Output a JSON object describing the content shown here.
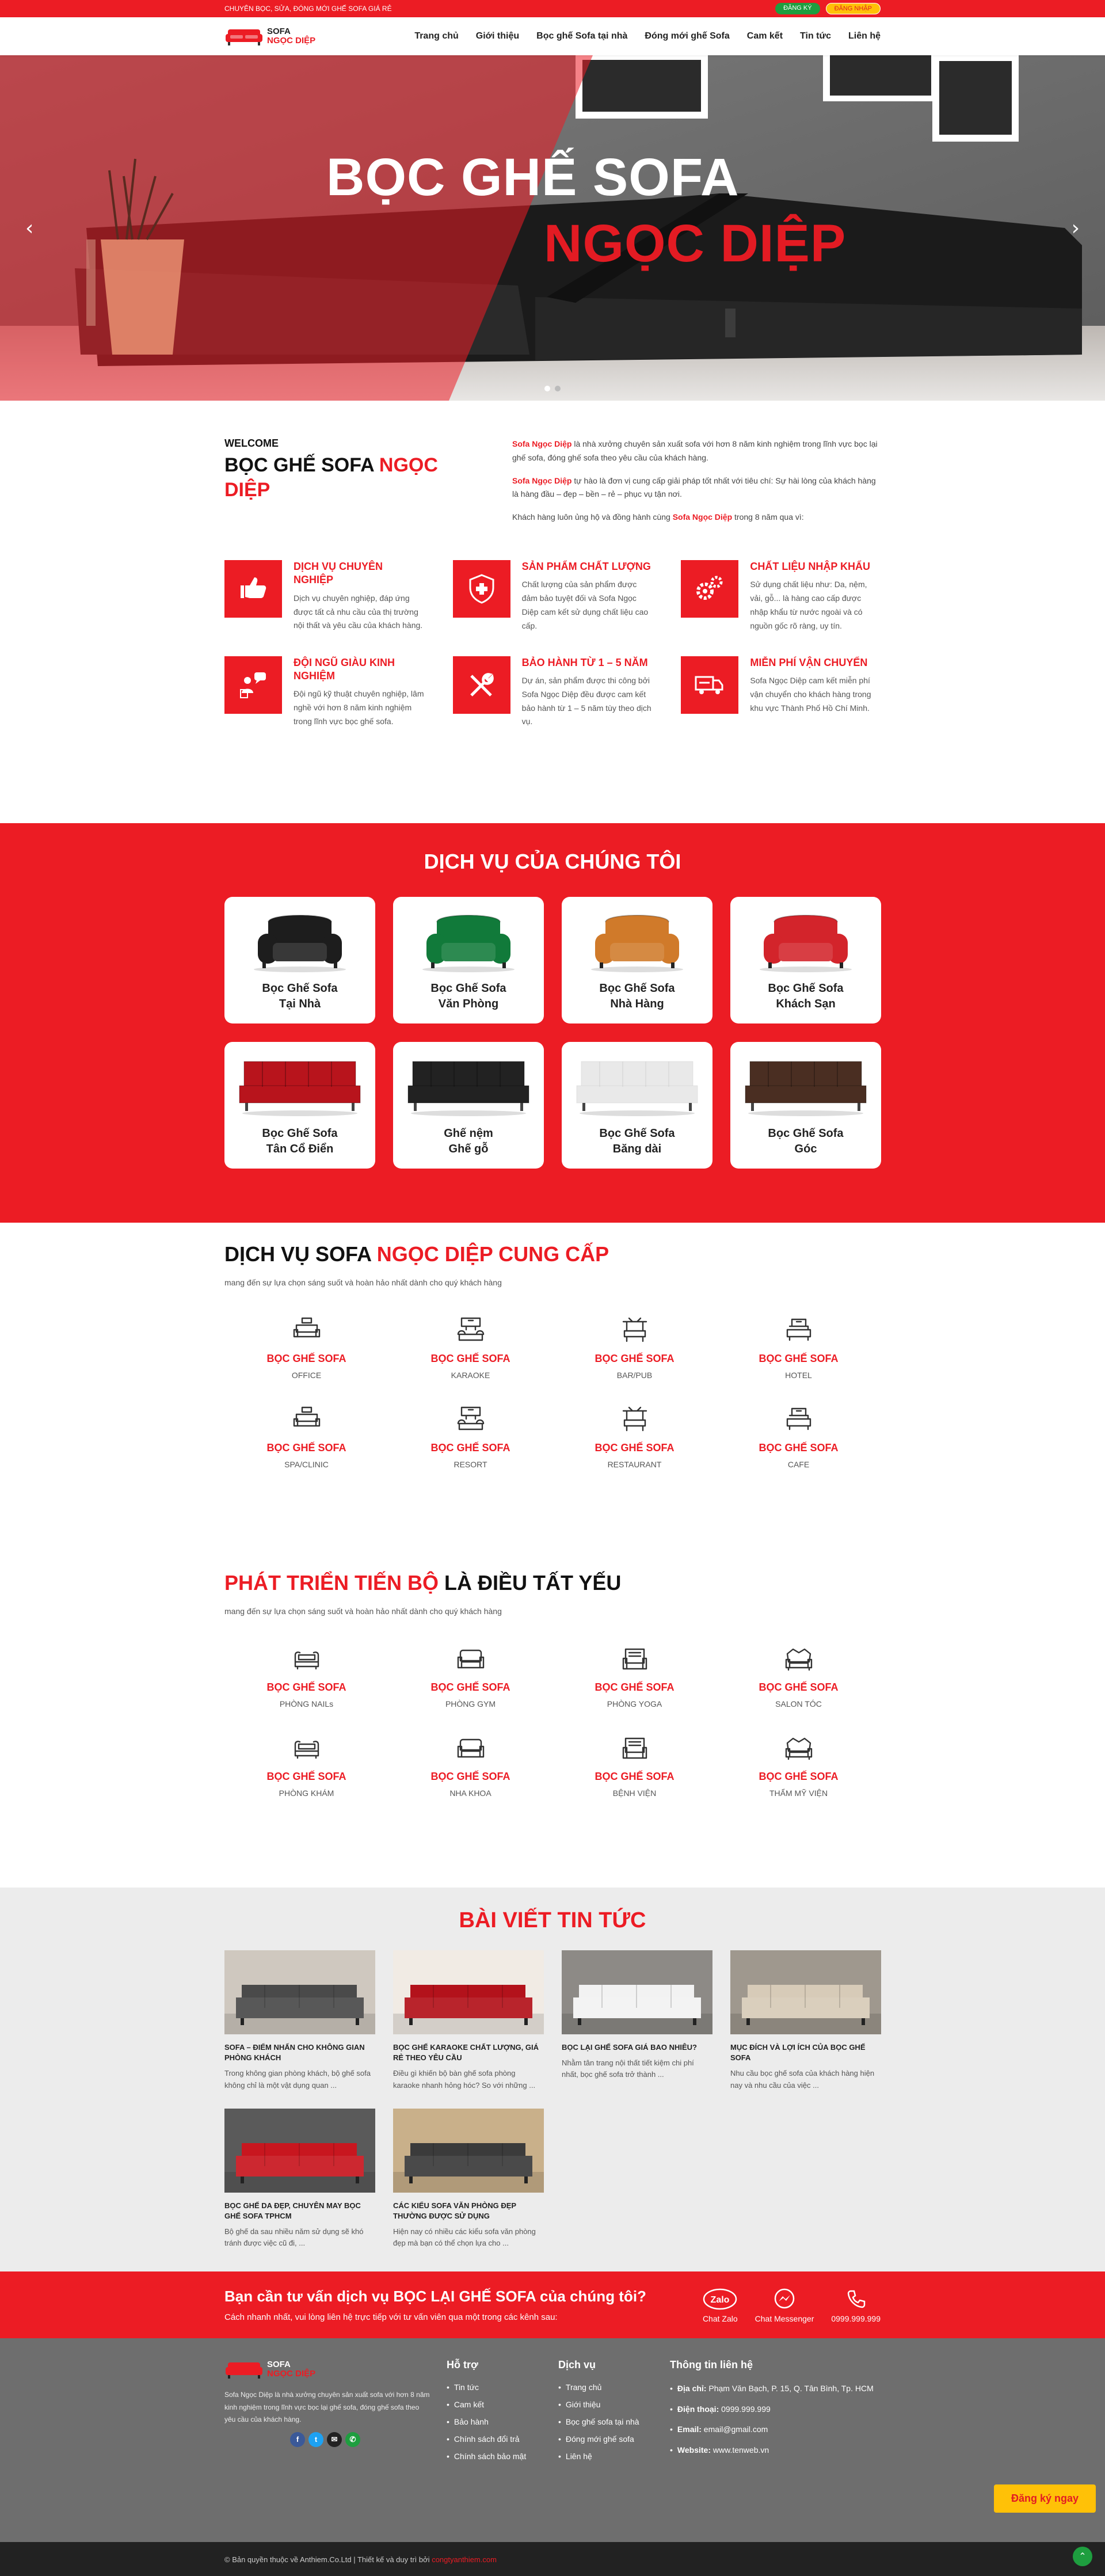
{
  "topbar": {
    "tagline": "CHUYÊN BỌC, SỬA, ĐÓNG MỚI GHẾ SOFA GIÁ RẺ",
    "register": "ĐĂNG KÝ",
    "login": "ĐĂNG NHẬP"
  },
  "logo": {
    "line1": "SOFA",
    "line2": "NGỌC DIỆP"
  },
  "nav": [
    "Trang chủ",
    "Giới thiệu",
    "Bọc ghế Sofa tại nhà",
    "Đóng mới ghế Sofa",
    "Cam kết",
    "Tin tức",
    "Liên hệ"
  ],
  "hero": {
    "line1": "BỌC GHẾ SOFA",
    "line2": "NGỌC DIỆP",
    "prev": "‹",
    "next": "›"
  },
  "welcome": {
    "label": "WELCOME",
    "title_a": "BỌC GHẾ SOFA ",
    "title_b": "NGỌC DIỆP",
    "p1_brand": "Sofa Ngọc Diệp",
    "p1_text": " là nhà xưởng chuyên sản xuất sofa với hơn 8 năm kinh nghiệm trong lĩnh vực bọc lại ghế sofa, đóng ghế sofa theo yêu cầu của khách hàng.",
    "p2_brand": "Sofa Ngọc Diệp",
    "p2_text": " tự hào là đơn vị cung cấp giải pháp tốt nhất với tiêu chí: Sự hài lòng của khách hàng là hàng đầu – đẹp – bền – rẻ – phục vụ tận nơi.",
    "p3_a": "Khách hàng luôn ủng hộ và đồng hành cùng ",
    "p3_brand": "Sofa Ngọc Diệp",
    "p3_b": " trong 8 năm qua vì:"
  },
  "features": [
    {
      "icon": "thumbs-up-icon",
      "title": "DỊCH VỤ CHUYÊN NGHIỆP",
      "desc": "Dịch vụ chuyên nghiệp, đáp ứng được tất cả nhu cầu của thị trường nội thất và yêu cầu của khách hàng."
    },
    {
      "icon": "shield-plus-icon",
      "title": "SẢN PHẨM CHẤT LƯỢNG",
      "desc": "Chất lượng của sản phẩm được đảm bảo tuyệt đối và Sofa Ngọc Diệp cam kết sử dụng chất liệu cao cấp."
    },
    {
      "icon": "gears-icon",
      "title": "CHẤT LIỆU NHẬP KHẨU",
      "desc": "Sử dụng chất liệu như: Da, nệm, vải, gỗ... là hàng cao cấp được nhập khẩu từ nước ngoài và có nguồn gốc rõ ràng, uy tín."
    },
    {
      "icon": "team-icon",
      "title": "ĐỘI NGŨ GIÀU KINH NGHIỆM",
      "desc": "Đội ngũ kỹ thuật chuyên nghiệp, lâm nghề với hơn 8 năm kinh nghiệm trong lĩnh vực bọc ghế sofa."
    },
    {
      "icon": "tools-icon",
      "title": "BẢO HÀNH TỪ 1 – 5 NĂM",
      "desc": "Dự án, sản phẩm được thi công bởi Sofa Ngọc Diệp đều được cam kết bảo hành từ 1 – 5 năm tùy theo dịch vụ."
    },
    {
      "icon": "truck-icon",
      "title": "MIỄN PHÍ VẬN CHUYỂN",
      "desc": "Sofa Ngọc Diệp cam kết miễn phí vận chuyển cho khách hàng trong khu vực Thành Phố Hồ Chí Minh."
    }
  ],
  "services": {
    "title": "DỊCH VỤ CỦA CHÚNG TÔI",
    "items": [
      {
        "l1": "Bọc Ghế Sofa",
        "l2": "Tại Nhà",
        "kind": "chair",
        "color": "#1d1d1d"
      },
      {
        "l1": "Bọc Ghế Sofa",
        "l2": "Văn Phòng",
        "kind": "chair",
        "color": "#117a3a"
      },
      {
        "l1": "Bọc Ghế Sofa",
        "l2": "Nhà Hàng",
        "kind": "chair",
        "color": "#d07a2a"
      },
      {
        "l1": "Bọc Ghế Sofa",
        "l2": "Khách Sạn",
        "kind": "chair",
        "color": "#d3242b"
      },
      {
        "l1": "Bọc Ghế Sofa",
        "l2": "Tân Cổ Điển",
        "kind": "bed",
        "color": "#b8141c"
      },
      {
        "l1": "Ghế nệm",
        "l2": "Ghế gỗ",
        "kind": "bed",
        "color": "#222222"
      },
      {
        "l1": "Bọc Ghế Sofa",
        "l2": "Băng dài",
        "kind": "bed",
        "color": "#e9e9e9"
      },
      {
        "l1": "Bọc Ghế Sofa",
        "l2": "Góc",
        "kind": "bed",
        "color": "#4a2e22"
      }
    ]
  },
  "supply": {
    "title_a": "DỊCH VỤ SOFA ",
    "title_b": "NGỌC DIỆP CUNG CẤP",
    "subtitle": "mang đến sự lựa chọn sáng suốt và hoàn hảo nhất dành cho quý khách hàng",
    "items": [
      {
        "icon": "office-icon",
        "h": "BỌC GHẾ SOFA",
        "s": "OFFICE"
      },
      {
        "icon": "karaoke-icon",
        "h": "BỌC GHẾ SOFA",
        "s": "KARAOKE"
      },
      {
        "icon": "bar-icon",
        "h": "BỌC GHẾ SOFA",
        "s": "BAR/PUB"
      },
      {
        "icon": "hotel-icon",
        "h": "BỌC GHẾ SOFA",
        "s": "HOTEL"
      },
      {
        "icon": "spa-icon",
        "h": "BỌC GHẾ SOFA",
        "s": "SPA/CLINIC"
      },
      {
        "icon": "resort-icon",
        "h": "BỌC GHẾ SOFA",
        "s": "RESORT"
      },
      {
        "icon": "restaurant-icon",
        "h": "BỌC GHẾ SOFA",
        "s": "RESTAURANT"
      },
      {
        "icon": "cafe-icon",
        "h": "BỌC GHẾ SOFA",
        "s": "CAFE"
      }
    ]
  },
  "progress": {
    "title_a": "PHÁT TRIỂN TIẾN BỘ",
    "title_b": " LÀ ĐIỀU TẤT YẾU",
    "subtitle": "mang đến sự lựa chọn sáng suốt và hoàn hảo nhất dành cho quý khách hàng",
    "items": [
      {
        "icon": "sofa-nail-icon",
        "h": "BỌC GHẾ SOFA",
        "s": "PHÒNG NAILs"
      },
      {
        "icon": "armchair-icon",
        "h": "BỌC GHẾ SOFA",
        "s": "PHÒNG GYM"
      },
      {
        "icon": "armchair-yoga-icon",
        "h": "BỌC GHẾ SOFA",
        "s": "PHÒNG YOGA"
      },
      {
        "icon": "sofa-salon-icon",
        "h": "BỌC GHẾ SOFA",
        "s": "SALON TÓC"
      },
      {
        "icon": "sofa-tufted-icon",
        "h": "BỌC GHẾ SOFA",
        "s": "PHÒNG KHÁM"
      },
      {
        "icon": "armchair-dental-icon",
        "h": "BỌC GHẾ SOFA",
        "s": "NHA KHOA"
      },
      {
        "icon": "sofa-hospital-icon",
        "h": "BỌC GHẾ SOFA",
        "s": "BỆNH VIỆN"
      },
      {
        "icon": "sofa-beauty-icon",
        "h": "BỌC GHẾ SOFA",
        "s": "THẨM MỸ VIỆN"
      }
    ]
  },
  "news": {
    "title": "BÀI VIẾT TIN TỨC",
    "posts": [
      {
        "title": "SOFA – ĐIỂM NHẤN CHO KHÔNG GIAN PHÒNG KHÁCH",
        "excerpt": "Trong không gian phòng khách, bộ ghế sofa không chỉ là một vật dụng quan ...",
        "sofa": "#4a4a4a",
        "bg": "#cfc8bf"
      },
      {
        "title": "BỌC GHẾ KARAOKE CHẤT LƯỢNG, GIÁ RẺ THEO YÊU CẦU",
        "excerpt": "Điều gì khiến bộ bàn ghế sofa phòng karaoke nhanh hỏng hóc? So với những ...",
        "sofa": "#b3121b",
        "bg": "#f1ebe4"
      },
      {
        "title": "BỌC LẠI GHẾ SOFA GIÁ BAO NHIÊU?",
        "excerpt": "Nhằm tân trang nội thất tiết kiệm chi phí nhất, bọc ghế sofa trở thành ...",
        "sofa": "#f2f2f2",
        "bg": "#8d8a86"
      },
      {
        "title": "MỤC ĐÍCH VÀ LỢI ÍCH CỦA BỌC GHẾ SOFA",
        "excerpt": "Nhu cầu bọc ghế sofa của khách hàng hiện nay và nhu cầu của việc ...",
        "sofa": "#d7cbb8",
        "bg": "#9f988e"
      },
      {
        "title": "BỌC GHẾ DA ĐẸP, CHUYÊN MAY BỌC GHẾ SOFA TPHCM",
        "excerpt": "Bộ ghế da sau nhiều năm sử dụng sẽ khó tránh được việc cũ đi, ...",
        "sofa": "#c8161f",
        "bg": "#5a5a5a"
      },
      {
        "title": "CÁC KIỂU SOFA VĂN PHÒNG ĐẸP THƯỜNG ĐƯỢC SỬ DỤNG",
        "excerpt": "Hiện nay có nhiều các kiểu sofa văn phòng đẹp mà bạn có thể chọn lựa cho ...",
        "sofa": "#3b3b3b",
        "bg": "#c9b08a"
      }
    ]
  },
  "cta": {
    "title": "Bạn cần tư vấn dịch vụ BỌC LẠI GHẾ SOFA của chúng tôi?",
    "sub": "Cách nhanh nhất, vui lòng liên hệ trực tiếp với tư vấn viên qua một trong các kênh sau:",
    "zalo_logo": "Zalo",
    "zalo": "Chat Zalo",
    "messenger": "Chat Messenger",
    "phone": "0999.999.999"
  },
  "footer": {
    "logo1": "SOFA",
    "logo2": "NGỌC DIỆP",
    "about": "Sofa Ngọc Diệp là nhà xưởng chuyên sản xuất sofa với hơn 8 năm kinh nghiệm trong lĩnh vực bọc lại ghế sofa, đóng ghế sofa theo yêu cầu của khách hàng.",
    "social": [
      "f",
      "t",
      "✉",
      "✆"
    ],
    "support_title": "Hỗ trợ",
    "support": [
      "Tin tức",
      "Cam kết",
      "Bảo hành",
      "Chính sách đổi trả",
      "Chính sách bảo mật"
    ],
    "services_title": "Dịch vụ",
    "services": [
      "Trang chủ",
      "Giới thiệu",
      "Bọc ghế sofa tại nhà",
      "Đóng mới ghế sofa",
      "Liên hệ"
    ],
    "contact_title": "Thông tin liên hệ",
    "contact": [
      {
        "k": "Địa chỉ:",
        "v": " Phạm Văn Bạch, P. 15, Q. Tân Bình, Tp. HCM"
      },
      {
        "k": "Điện thoại:",
        "v": " 0999.999.999"
      },
      {
        "k": "Email:",
        "v": " email@gmail.com"
      },
      {
        "k": "Website:",
        "v": " www.tenweb.vn"
      }
    ],
    "register_btn": "Đăng ký ngay"
  },
  "copyright": {
    "a": "© Bản quyền thuộc về Anthiem.Co.Ltd  |  Thiết kế và duy trì bởi ",
    "b": "congtyanthiem.com"
  },
  "colors": {
    "brand": "#ec1c24",
    "accent": "#ffc107",
    "green": "#1e9e3f"
  }
}
